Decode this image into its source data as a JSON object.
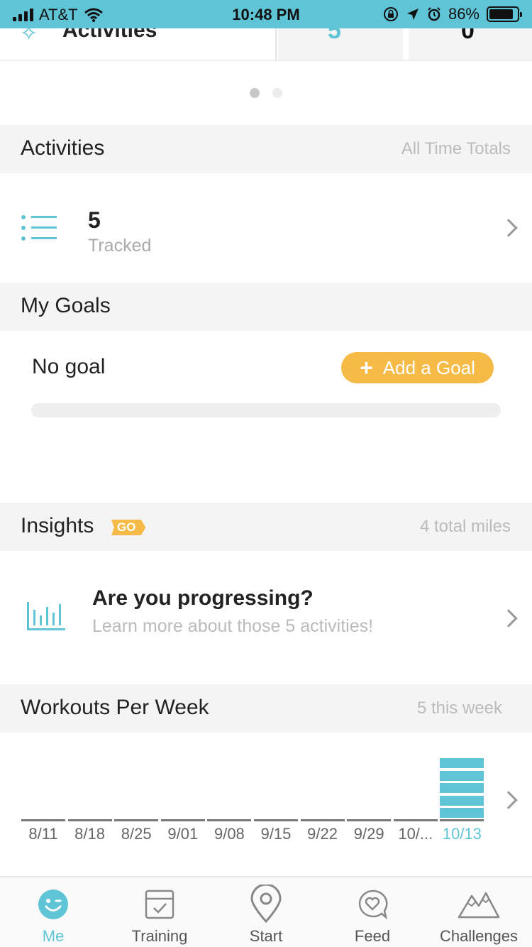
{
  "status_bar": {
    "carrier": "AT&T",
    "time": "10:48 PM",
    "battery_text": "86%",
    "battery_level": 0.86
  },
  "top_cards": {
    "main_label": "Activities",
    "card2_value": "5",
    "card3_value": "0"
  },
  "pager": {
    "count": 2,
    "active_index": 0
  },
  "activities": {
    "title": "Activities",
    "aside": "All Time Totals",
    "count": "5",
    "sub": "Tracked"
  },
  "goals": {
    "title": "My Goals",
    "status": "No goal",
    "add_label": "Add a Goal",
    "progress": 0
  },
  "insights": {
    "title": "Insights",
    "badge": "GO",
    "aside": "4 total miles",
    "headline": "Are you progressing?",
    "sub": "Learn more about those 5 activities!"
  },
  "workouts": {
    "title": "Workouts Per Week",
    "aside": "5 this week"
  },
  "chart_data": {
    "type": "bar",
    "categories": [
      "8/11",
      "8/18",
      "8/25",
      "9/01",
      "9/08",
      "9/15",
      "9/22",
      "9/29",
      "10/...",
      "10/13"
    ],
    "values": [
      0,
      0,
      0,
      0,
      0,
      0,
      0,
      0,
      0,
      5
    ],
    "highlight_index": 9,
    "color": "#5fc4d5"
  },
  "tab_bar": {
    "tabs": [
      {
        "label": "Me",
        "icon": "smiley-icon",
        "active": true
      },
      {
        "label": "Training",
        "icon": "checklist-icon",
        "active": false
      },
      {
        "label": "Start",
        "icon": "location-pin-icon",
        "active": false
      },
      {
        "label": "Feed",
        "icon": "chat-heart-icon",
        "active": false
      },
      {
        "label": "Challenges",
        "icon": "mountains-icon",
        "active": false
      }
    ]
  },
  "colors": {
    "accent": "#5fc4d5",
    "goal_orange": "#f6bb47",
    "header_bg": "#f4f4f4",
    "muted_text": "#bbbbbb"
  }
}
